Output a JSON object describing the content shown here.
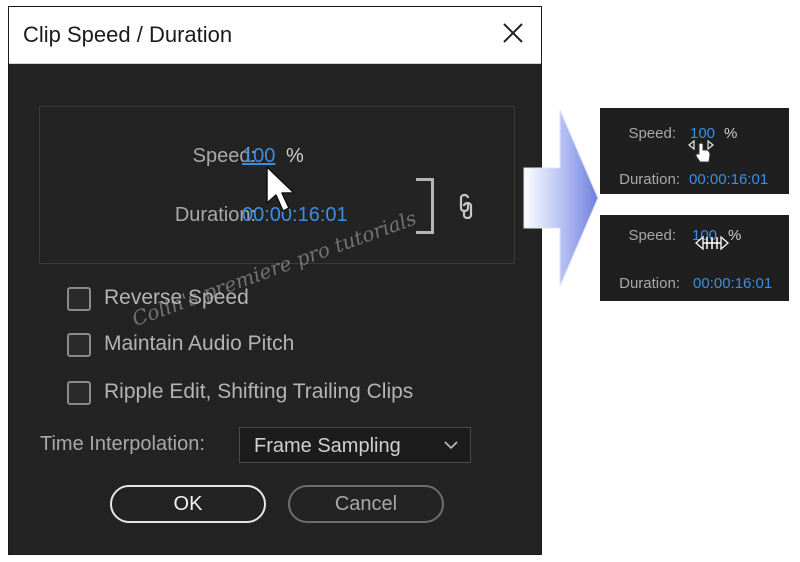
{
  "dialog": {
    "title": "Clip Speed / Duration",
    "close_icon": "close-icon",
    "speed": {
      "label": "Speed:",
      "value": "100",
      "unit": "%"
    },
    "duration": {
      "label": "Duration:",
      "value": "00:00:16:01"
    },
    "link_icon": "chain-link-icon",
    "checkboxes": [
      {
        "label": "Reverse Speed",
        "checked": false
      },
      {
        "label": "Maintain Audio Pitch",
        "checked": false
      },
      {
        "label": "Ripple Edit, Shifting Trailing Clips",
        "checked": false
      }
    ],
    "time_interpolation": {
      "label": "Time Interpolation:",
      "value": "Frame Sampling"
    },
    "buttons": {
      "ok": "OK",
      "cancel": "Cancel"
    },
    "watermark": "Colin's premiere pro tutorials"
  },
  "insets": [
    {
      "speed_label": "Speed:",
      "speed_value": "100",
      "unit": "%",
      "duration_label": "Duration:",
      "duration_value": "00:00:16:01",
      "cursor": "hand-pointer-icon"
    },
    {
      "speed_label": "Speed:",
      "speed_value": "100",
      "unit": "%",
      "duration_label": "Duration:",
      "duration_value": "00:00:16:01",
      "cursor": "horizontal-scrub-icon"
    }
  ],
  "colors": {
    "dialog_bg": "#232323",
    "value_blue": "#3a8fe4",
    "arrow_blue": "#8a98e8"
  }
}
